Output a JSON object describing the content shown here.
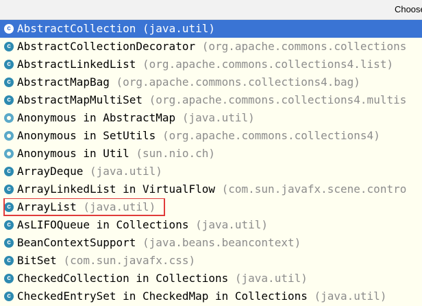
{
  "header": {
    "title": "Choose I"
  },
  "items": [
    {
      "name": "AbstractCollection",
      "package": "(java.util)",
      "icon": "class-icon",
      "selected": true
    },
    {
      "name": "AbstractCollectionDecorator",
      "package": "(org.apache.commons.collections",
      "icon": "class-icon"
    },
    {
      "name": "AbstractLinkedList",
      "package": "(org.apache.commons.collections4.list)",
      "icon": "class-icon"
    },
    {
      "name": "AbstractMapBag",
      "package": "(org.apache.commons.collections4.bag)",
      "icon": "class-icon"
    },
    {
      "name": "AbstractMapMultiSet",
      "package": "(org.apache.commons.collections4.multis",
      "icon": "class-icon"
    },
    {
      "name": "Anonymous in AbstractMap",
      "package": "(java.util)",
      "icon": "anonymous-class-icon"
    },
    {
      "name": "Anonymous in SetUtils",
      "package": "(org.apache.commons.collections4)",
      "icon": "anonymous-class-icon"
    },
    {
      "name": "Anonymous in Util",
      "package": "(sun.nio.ch)",
      "icon": "anonymous-class-icon"
    },
    {
      "name": "ArrayDeque",
      "package": "(java.util)",
      "icon": "class-icon"
    },
    {
      "name": "ArrayLinkedList in VirtualFlow",
      "package": "(com.sun.javafx.scene.contro",
      "icon": "class-icon"
    },
    {
      "name": "ArrayList",
      "package": "(java.util)",
      "icon": "class-icon",
      "highlighted": true
    },
    {
      "name": "AsLIFOQueue in Collections",
      "package": "(java.util)",
      "icon": "class-icon"
    },
    {
      "name": "BeanContextSupport",
      "package": "(java.beans.beancontext)",
      "icon": "class-icon"
    },
    {
      "name": "BitSet",
      "package": "(com.sun.javafx.css)",
      "icon": "class-icon"
    },
    {
      "name": "CheckedCollection in Collections",
      "package": "(java.util)",
      "icon": "class-icon"
    },
    {
      "name": "CheckedEntrySet in CheckedMap in Collections",
      "package": "(java.util)",
      "icon": "class-icon"
    }
  ]
}
